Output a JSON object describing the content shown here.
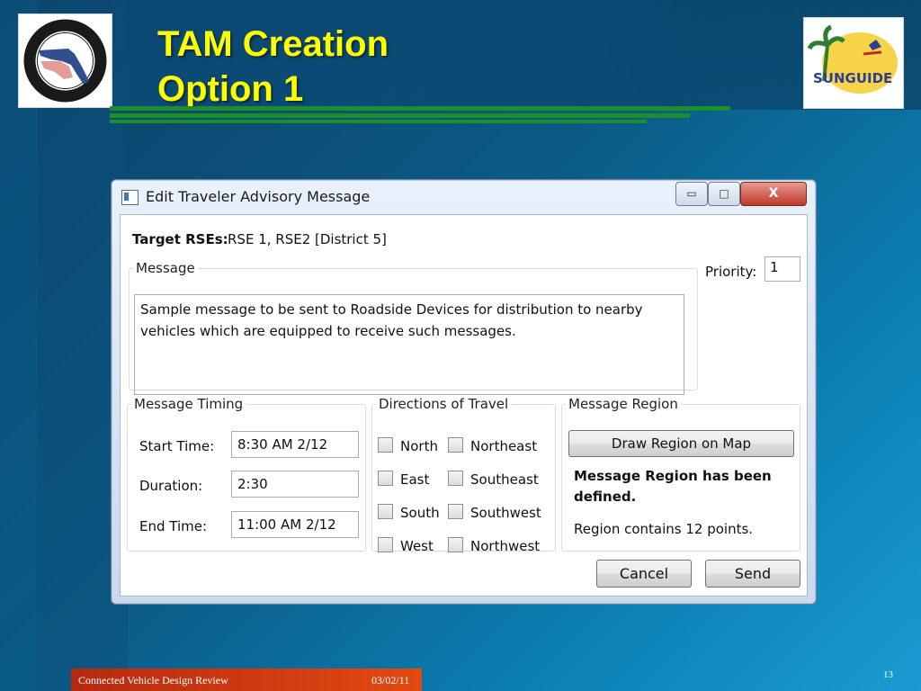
{
  "slide": {
    "title_line1": "TAM Creation",
    "title_line2": "Option 1",
    "logo_left": "fdot-logo",
    "logo_right": "sunguide-logo",
    "footer_left": "Connected Vehicle Design Review",
    "footer_date": "03/02/11",
    "page_number": "13",
    "colors": {
      "title": "#ffff00",
      "footer": "#d63c12",
      "rule": "#1d8f2a"
    }
  },
  "dialog": {
    "title": "Edit Traveler Advisory Message",
    "window_buttons": {
      "minimize": "▭",
      "maximize": "□",
      "close": "X"
    },
    "target_label": "Target RSEs:",
    "target_value": "RSE 1, RSE2 [District 5]",
    "message_legend": "Message",
    "message_text": "Sample message to be sent to Roadside Devices for distribution to nearby vehicles which are equipped to receive such messages.",
    "priority_label": "Priority:",
    "priority_value": "1",
    "timing": {
      "legend": "Message Timing",
      "start_label": "Start Time:",
      "start_value": "8:30 AM 2/12",
      "duration_label": "Duration:",
      "duration_value": "2:30",
      "end_label": "End Time:",
      "end_value": "11:00 AM 2/12"
    },
    "directions": {
      "legend": "Directions of Travel",
      "north": "North",
      "northeast": "Northeast",
      "east": "East",
      "southeast": "Southeast",
      "south": "South",
      "southwest": "Southwest",
      "west": "West",
      "northwest": "Northwest"
    },
    "region": {
      "legend": "Message Region",
      "draw_button": "Draw Region on Map",
      "status": "Message Region has been defined.",
      "info": "Region contains 12 points."
    },
    "cancel": "Cancel",
    "send": "Send"
  }
}
